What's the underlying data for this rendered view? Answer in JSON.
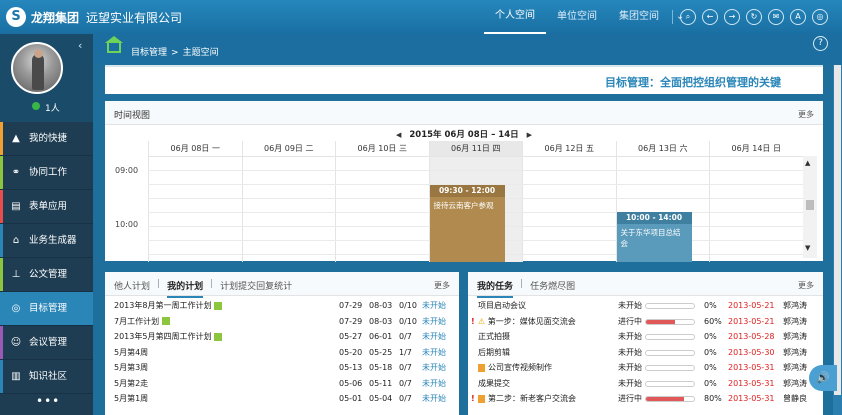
{
  "header": {
    "logo_text": "龙翔集团",
    "org_name": "远望实业有限公司",
    "nav": [
      "个人空间",
      "单位空间",
      "集团空间"
    ],
    "nav_more": "⌄",
    "icons": [
      "search-icon",
      "back-icon",
      "forward-icon",
      "refresh-icon",
      "chat-icon",
      "ab-icon",
      "settings-icon"
    ]
  },
  "sidebar": {
    "user_count": "1人",
    "items": [
      {
        "label": "我的快捷",
        "icon": "bolt-icon",
        "color": "#f0a030"
      },
      {
        "label": "协同工作",
        "icon": "flow-icon",
        "color": "#8cc63f"
      },
      {
        "label": "表单应用",
        "icon": "form-icon",
        "color": "#e84c4c"
      },
      {
        "label": "业务生成器",
        "icon": "builder-icon",
        "color": "#2b86b8"
      },
      {
        "label": "公文管理",
        "icon": "document-icon",
        "color": "#8cc63f"
      },
      {
        "label": "目标管理",
        "icon": "target-icon",
        "color": "#2b86b8"
      },
      {
        "label": "会议管理",
        "icon": "meeting-icon",
        "color": "#9b59b6"
      },
      {
        "label": "知识社区",
        "icon": "knowledge-icon",
        "color": "#2b86b8"
      }
    ],
    "more": "•••"
  },
  "breadcrumb": {
    "items": [
      "目标管理",
      "主题空间"
    ],
    "separator": ">"
  },
  "banner": {
    "text": "目标管理：全面把控组织管理的关键"
  },
  "timeview": {
    "title": "时间视图",
    "more": "更多",
    "week_label": "2015年 06月 08日 – 14日",
    "days": [
      "06月 08日 一",
      "06月 09日 二",
      "06月 10日 三",
      "06月 11日 四",
      "06月 12日 五",
      "06月 13日 六",
      "06月 14日 日"
    ],
    "today_index": 3,
    "times": [
      "09:00",
      "10:00"
    ],
    "events": [
      {
        "time": "09:30 - 12:00",
        "title": "接待云南客户参观",
        "color": "#b08a4f"
      },
      {
        "time": "10:00 - 14:00",
        "title": "关于东华项目总结会",
        "color": "#5a9bbb"
      }
    ]
  },
  "plans": {
    "tabs": [
      "他人计划",
      "我的计划",
      "计划提交回复统计"
    ],
    "active_tab": 1,
    "more": "更多",
    "rows": [
      {
        "name": "2013年8月第一周工作计划",
        "badge": true,
        "start": "07-29",
        "end": "08-03",
        "progress": "0/10",
        "status": "未开始"
      },
      {
        "name": "7月工作计划",
        "badge": true,
        "start": "07-29",
        "end": "08-03",
        "progress": "0/10",
        "status": "未开始"
      },
      {
        "name": "2013年5月第四周工作计划",
        "badge": true,
        "start": "05-27",
        "end": "06-01",
        "progress": "0/7",
        "status": "未开始"
      },
      {
        "name": "5月第4周",
        "badge": false,
        "start": "05-20",
        "end": "05-25",
        "progress": "1/7",
        "status": "未开始"
      },
      {
        "name": "5月第3周",
        "badge": false,
        "start": "05-13",
        "end": "05-18",
        "progress": "0/7",
        "status": "未开始"
      },
      {
        "name": "5月第2走",
        "badge": false,
        "start": "05-06",
        "end": "05-11",
        "progress": "0/7",
        "status": "未开始"
      },
      {
        "name": "5月第1周",
        "badge": false,
        "start": "05-01",
        "end": "05-04",
        "progress": "0/7",
        "status": "未开始"
      }
    ]
  },
  "tasks": {
    "tabs": [
      "我的任务",
      "任务燃尽图"
    ],
    "active_tab": 0,
    "more": "更多",
    "rows": [
      {
        "prefix": "",
        "icon": "",
        "name": "项目启动会议",
        "status": "未开始",
        "pct": "0%",
        "fill": 0,
        "date": "2013-05-21",
        "owner": "郭鸿涛"
      },
      {
        "prefix": "!",
        "icon": "warning-icon",
        "name": "第一步：媒体见面交流会",
        "status": "进行中",
        "pct": "60%",
        "fill": 0.6,
        "date": "2013-05-21",
        "owner": "郭鸿涛"
      },
      {
        "prefix": "",
        "icon": "",
        "name": "正式拍摄",
        "status": "未开始",
        "pct": "0%",
        "fill": 0,
        "date": "2013-05-28",
        "owner": "郭鸿涛"
      },
      {
        "prefix": "",
        "icon": "",
        "name": "后期剪辑",
        "status": "未开始",
        "pct": "0%",
        "fill": 0,
        "date": "2013-05-30",
        "owner": "郭鸿涛"
      },
      {
        "prefix": "",
        "icon": "doc-icon",
        "name": "公司宣传视频制作",
        "status": "未开始",
        "pct": "0%",
        "fill": 0,
        "date": "2013-05-31",
        "owner": "郭鸿涛"
      },
      {
        "prefix": "",
        "icon": "",
        "name": "成果提交",
        "status": "未开始",
        "pct": "0%",
        "fill": 0,
        "date": "2013-05-31",
        "owner": "郭鸿涛"
      },
      {
        "prefix": "!",
        "icon": "doc-icon",
        "name": "第二步：新老客户交流会",
        "status": "进行中",
        "pct": "80%",
        "fill": 0.8,
        "date": "2013-05-31",
        "owner": "曾静良"
      }
    ]
  }
}
